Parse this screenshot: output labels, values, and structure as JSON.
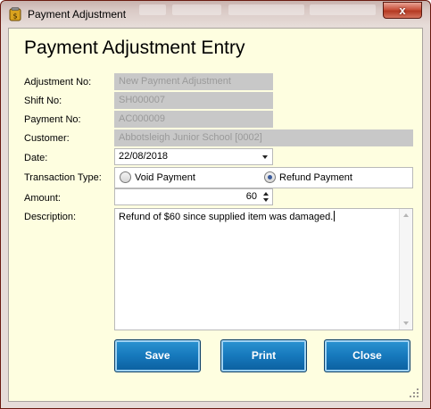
{
  "window": {
    "title": "Payment Adjustment",
    "close_glyph": "x",
    "icon": "payment-app-icon"
  },
  "form": {
    "heading": "Payment Adjustment Entry",
    "adjustment_no": {
      "label": "Adjustment No:",
      "value": "New Payment Adjustment"
    },
    "shift_no": {
      "label": "Shift No:",
      "value": "SH000007"
    },
    "payment_no": {
      "label": "Payment No:",
      "value": "AC000009"
    },
    "customer": {
      "label": "Customer:",
      "value": "Abbotsleigh Junior School [0002]"
    },
    "date": {
      "label": "Date:",
      "value": "22/08/2018"
    },
    "transaction_type": {
      "label": "Transaction Type:",
      "options": [
        {
          "label": "Void Payment",
          "selected": false
        },
        {
          "label": "Refund Payment",
          "selected": true
        }
      ]
    },
    "amount": {
      "label": "Amount:",
      "value": "60"
    },
    "description": {
      "label": "Description:",
      "value": "Refund of $60 since supplied item was damaged."
    }
  },
  "buttons": {
    "save": "Save",
    "print": "Print",
    "close": "Close"
  },
  "colors": {
    "client_bg": "#fefee0",
    "button_blue": "#1678bc",
    "close_red": "#c9523c"
  }
}
